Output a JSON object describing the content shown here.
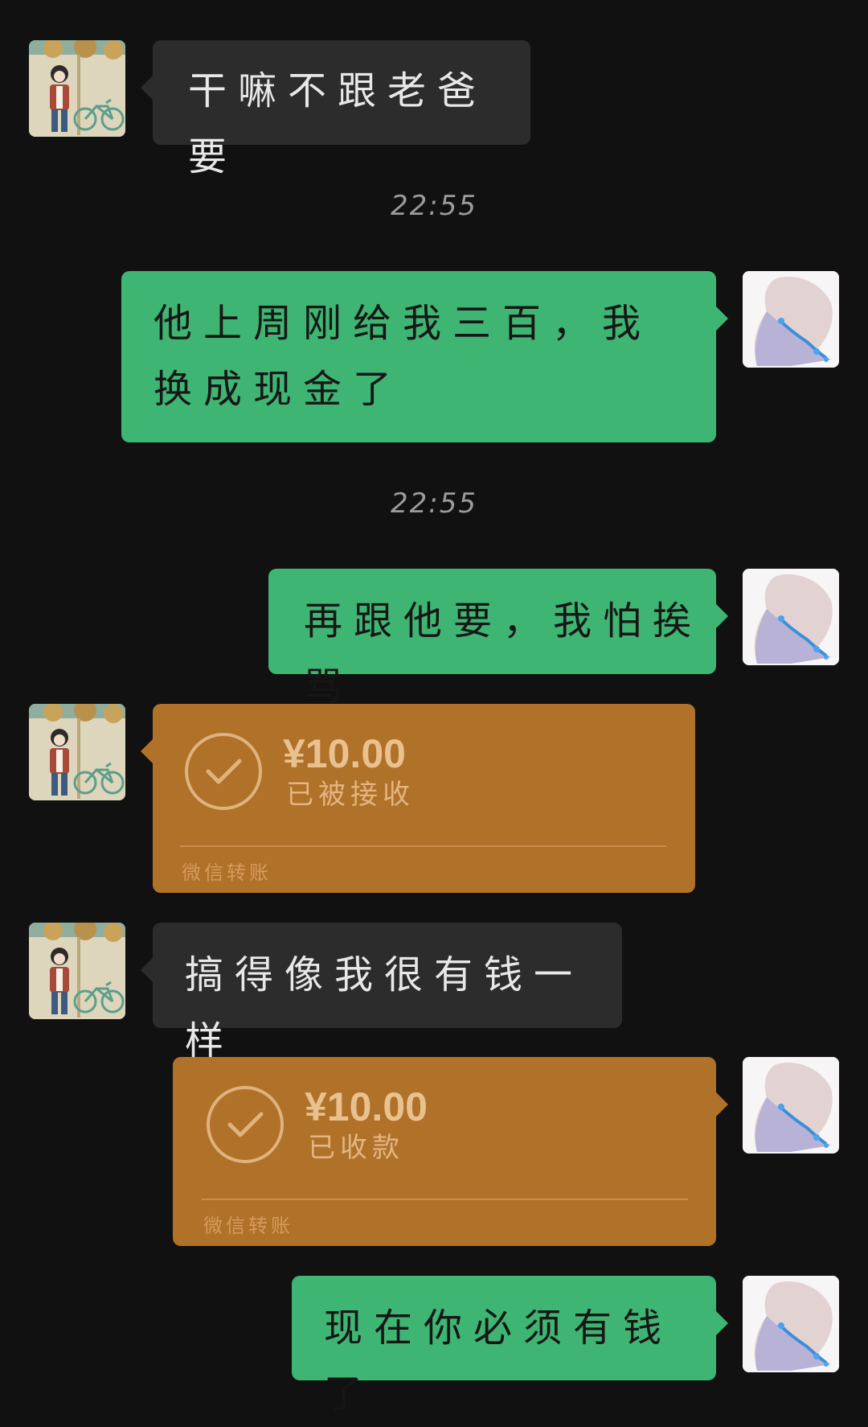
{
  "messages": [
    {
      "text": "干嘛不跟老爸要"
    },
    {
      "time": "22:55"
    },
    {
      "text": "他上周刚给我三百，我换成现金了"
    },
    {
      "time": "22:55"
    },
    {
      "text": "再跟他要，我怕挨骂"
    },
    {
      "amount": "¥10.00",
      "status": "已被接收",
      "service": "微信转账"
    },
    {
      "text": "搞得像我很有钱一样"
    },
    {
      "amount": "¥10.00",
      "status": "已收款",
      "service": "微信转账"
    },
    {
      "text": "现在你必须有钱了"
    }
  ],
  "colors": {
    "background": "#111111",
    "incoming_bubble": "#2c2c2c",
    "outgoing_bubble": "#3eb573",
    "transfer_card": "#b07129"
  }
}
